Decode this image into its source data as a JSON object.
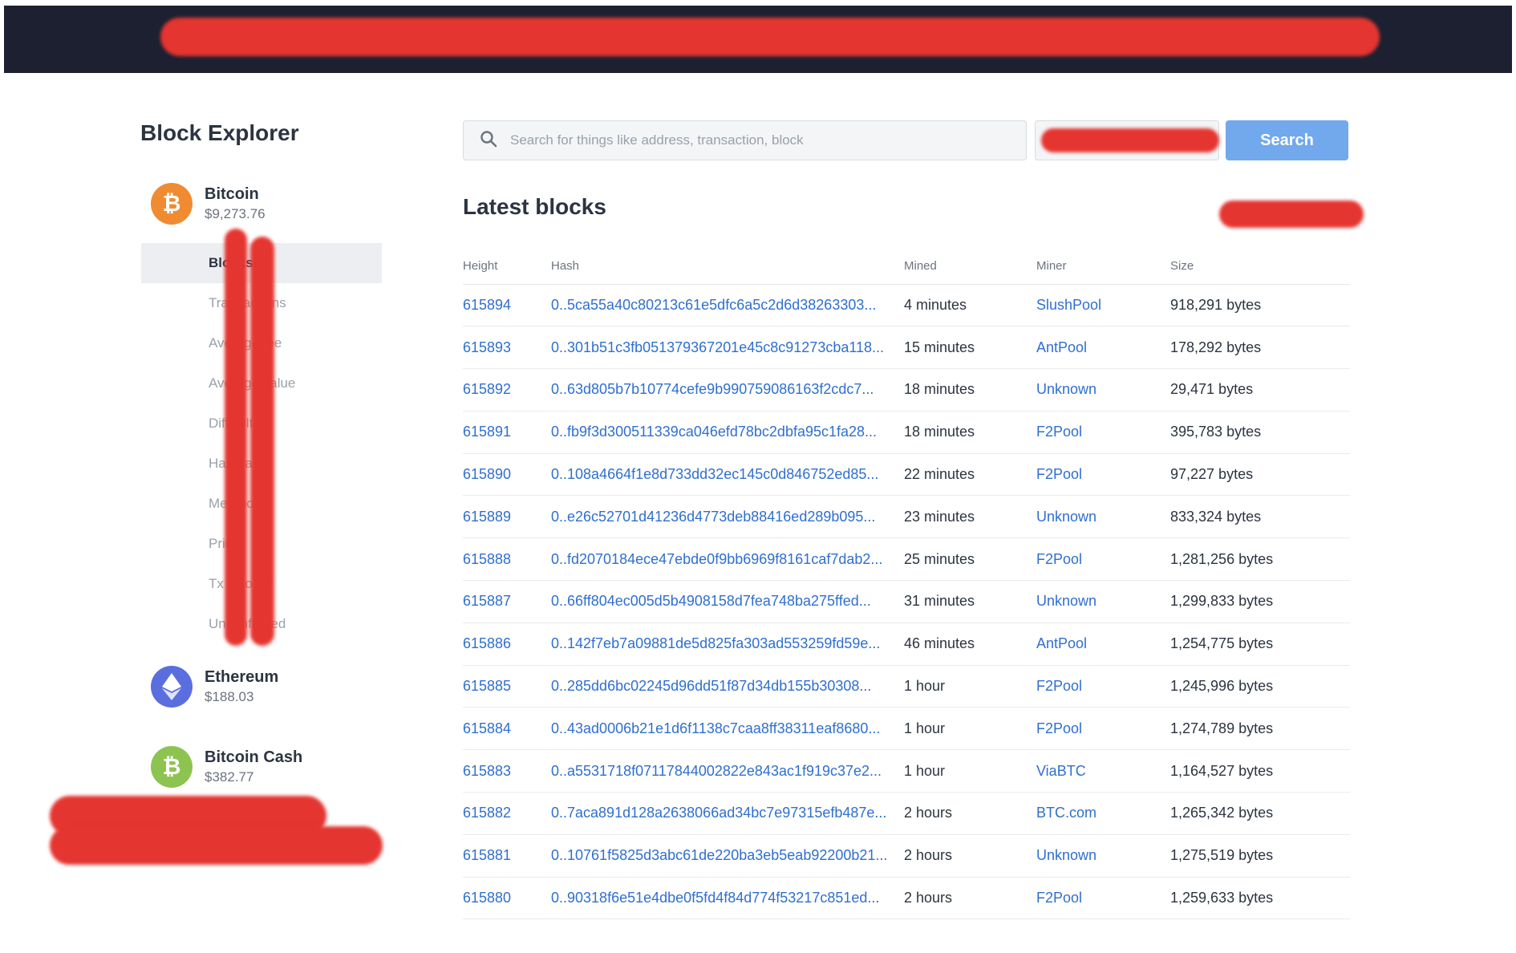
{
  "sidebar": {
    "title": "Block Explorer",
    "coins": [
      {
        "name": "Bitcoin",
        "price": "$9,273.76",
        "icon": "bitcoin-icon",
        "color": "#f08b32"
      },
      {
        "name": "Ethereum",
        "price": "$188.03",
        "icon": "ethereum-icon",
        "color": "#5b6ee0"
      },
      {
        "name": "Bitcoin Cash",
        "price": "$382.77",
        "icon": "bitcoin-cash-icon",
        "color": "#8dc451"
      }
    ],
    "subnav": [
      "Blocks",
      "Transactions",
      "Average fee",
      "Average value",
      "Difficulty",
      "Hashrate",
      "Mempool",
      "Price",
      "Tx velocity",
      "Unconfirmed"
    ]
  },
  "search": {
    "placeholder": "Search for things like address, transaction, block",
    "button": "Search"
  },
  "main": {
    "title": "Latest blocks",
    "columns": [
      "Height",
      "Hash",
      "Mined",
      "Miner",
      "Size"
    ],
    "rows": [
      {
        "height": "615894",
        "hash": "0..5ca55a40c80213c61e5dfc6a5c2d6d38263303...",
        "mined": "4 minutes",
        "miner": "SlushPool",
        "size": "918,291 bytes"
      },
      {
        "height": "615893",
        "hash": "0..301b51c3fb051379367201e45c8c91273cba118...",
        "mined": "15 minutes",
        "miner": "AntPool",
        "size": "178,292 bytes"
      },
      {
        "height": "615892",
        "hash": "0..63d805b7b10774cefe9b990759086163f2cdc7...",
        "mined": "18 minutes",
        "miner": "Unknown",
        "size": "29,471 bytes"
      },
      {
        "height": "615891",
        "hash": "0..fb9f3d300511339ca046efd78bc2dbfa95c1fa28...",
        "mined": "18 minutes",
        "miner": "F2Pool",
        "size": "395,783 bytes"
      },
      {
        "height": "615890",
        "hash": "0..108a4664f1e8d733dd32ec145c0d846752ed85...",
        "mined": "22 minutes",
        "miner": "F2Pool",
        "size": "97,227 bytes"
      },
      {
        "height": "615889",
        "hash": "0..e26c52701d41236d4773deb88416ed289b095...",
        "mined": "23 minutes",
        "miner": "Unknown",
        "size": "833,324 bytes"
      },
      {
        "height": "615888",
        "hash": "0..fd2070184ece47ebde0f9bb6969f8161caf7dab2...",
        "mined": "25 minutes",
        "miner": "F2Pool",
        "size": "1,281,256 bytes"
      },
      {
        "height": "615887",
        "hash": "0..66ff804ec005d5b4908158d7fea748ba275ffed...",
        "mined": "31 minutes",
        "miner": "Unknown",
        "size": "1,299,833 bytes"
      },
      {
        "height": "615886",
        "hash": "0..142f7eb7a09881de5d825fa303ad553259fd59e...",
        "mined": "46 minutes",
        "miner": "AntPool",
        "size": "1,254,775 bytes"
      },
      {
        "height": "615885",
        "hash": "0..285dd6bc02245d96dd51f87d34db155b30308...",
        "mined": "1 hour",
        "miner": "F2Pool",
        "size": "1,245,996 bytes"
      },
      {
        "height": "615884",
        "hash": "0..43ad0006b21e1d6f1138c7caa8ff38311eaf8680...",
        "mined": "1 hour",
        "miner": "F2Pool",
        "size": "1,274,789 bytes"
      },
      {
        "height": "615883",
        "hash": "0..a5531718f07117844002822e843ac1f919c37e2...",
        "mined": "1 hour",
        "miner": "ViaBTC",
        "size": "1,164,527 bytes"
      },
      {
        "height": "615882",
        "hash": "0..7aca891d128a2638066ad34bc7e97315efb487e...",
        "mined": "2 hours",
        "miner": "BTC.com",
        "size": "1,265,342 bytes"
      },
      {
        "height": "615881",
        "hash": "0..10761f5825d3abc61de220ba3eb5eab92200b21...",
        "mined": "2 hours",
        "miner": "Unknown",
        "size": "1,275,519 bytes"
      },
      {
        "height": "615880",
        "hash": "0..90318f6e51e4dbe0f5fd4f84d774f53217c851ed...",
        "mined": "2 hours",
        "miner": "F2Pool",
        "size": "1,259,633 bytes"
      }
    ]
  },
  "colors": {
    "accent": "#2f6fd0",
    "button": "#72a8ec",
    "topbar": "#1c2031",
    "redaction": "#e53530"
  }
}
